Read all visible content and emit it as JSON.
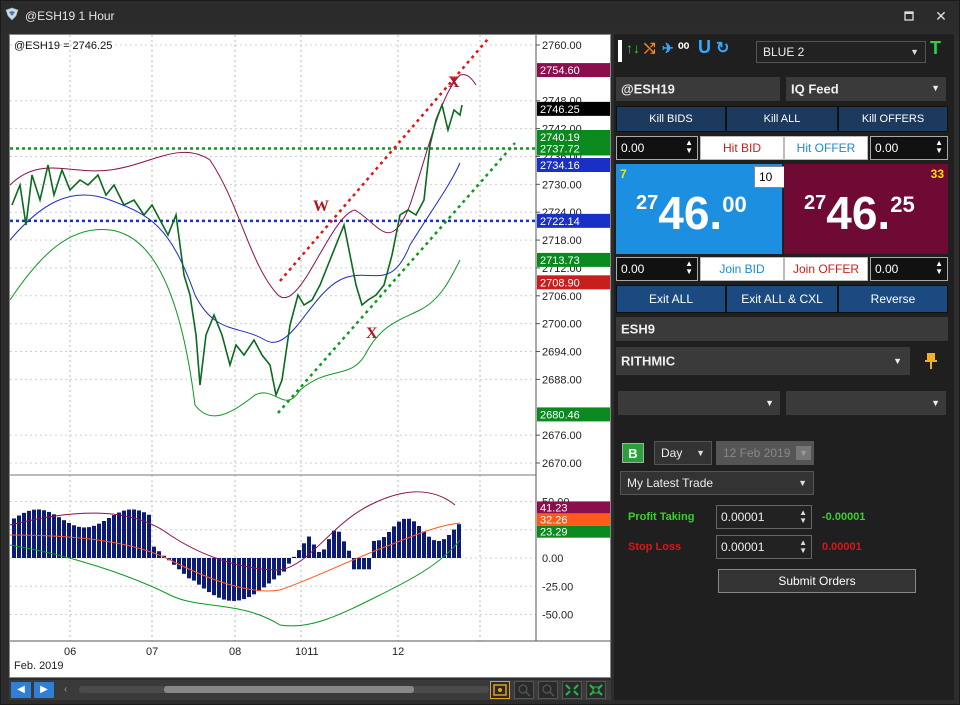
{
  "window": {
    "title": "@ESH19 1 Hour",
    "maximize_icon": "maximize-icon",
    "close_icon": "close-icon"
  },
  "chart": {
    "info": "@ESH19 = 2746.25",
    "date_label": "Feb. 2019",
    "x_labels": [
      "06",
      "07",
      "08",
      "1011",
      "12"
    ],
    "price_ticks": [
      "2760.00",
      "2748.00",
      "2742.00",
      "2736.00",
      "2730.00",
      "2724.00",
      "2718.00",
      "2712.00",
      "2706.00",
      "2700.00",
      "2694.00",
      "2688.00",
      "2676.00",
      "2670.00"
    ],
    "osc_ticks": [
      "50.00",
      "25.00",
      "0.00",
      "-25.00",
      "-50.00"
    ],
    "price_tags": [
      {
        "text": "2754.60",
        "bg": "#8b0f4e",
        "fg": "#ffffff"
      },
      {
        "text": "2746.25",
        "bg": "#000000",
        "fg": "#ffffff"
      },
      {
        "text": "2740.19",
        "bg": "#0a8a1e",
        "fg": "#ffffff"
      },
      {
        "text": "2737.72",
        "bg": "#0a8a1e",
        "fg": "#ffffff"
      },
      {
        "text": "2734.16",
        "bg": "#1a2ec8",
        "fg": "#ffffff"
      },
      {
        "text": "2722.14",
        "bg": "#1a2ec8",
        "fg": "#ffffff"
      },
      {
        "text": "2713.73",
        "bg": "#0a8a1e",
        "fg": "#ffffff"
      },
      {
        "text": "2708.90",
        "bg": "#c81e1e",
        "fg": "#ffffff"
      },
      {
        "text": "2680.46",
        "bg": "#0a8a1e",
        "fg": "#ffffff"
      }
    ],
    "osc_tags": [
      {
        "text": "41.23",
        "bg": "#8b0f4e"
      },
      {
        "text": "32.26",
        "bg": "#ff5a1a"
      },
      {
        "text": "23.29",
        "bg": "#0a8a1e"
      }
    ],
    "annotations": [
      "W",
      "X",
      "X"
    ]
  },
  "panel": {
    "toolbar_icons": [
      "arrows-icon",
      "shuffle-icon",
      "pin-icon",
      "counter-icon",
      "magnet-icon",
      "refresh-icon"
    ],
    "toolbar_glyphs": [
      "↑↓",
      "⤭",
      "✈",
      "⁰⁰",
      "U",
      "↻",
      "T"
    ],
    "account_select": "BLUE 2",
    "symbol": "@ESH19",
    "feed_select": "IQ Feed",
    "kill_bids": "Kill BIDS",
    "kill_all": "Kill ALL",
    "kill_offers": "Kill OFFERS",
    "bid_offset": "0.00",
    "hit_bid": "Hit BID",
    "hit_offer": "Hit OFFER",
    "offer_offset": "0.00",
    "bid_size": "7",
    "qty": "10",
    "offer_size": "33",
    "bid_price_prefix": "27",
    "bid_price_main": "46.",
    "bid_price_frac": "00",
    "offer_price_prefix": "27",
    "offer_price_main": "46.",
    "offer_price_frac": "25",
    "join_bid_offset": "0.00",
    "join_bid": "Join BID",
    "join_offer": "Join OFFER",
    "join_offer_offset": "0.00",
    "exit_all": "Exit ALL",
    "exit_all_cxl": "Exit ALL & CXL",
    "reverse": "Reverse",
    "contract": "ESH9",
    "broker_select": "RITHMIC",
    "sub_select_a": "",
    "sub_select_b": "",
    "b_button": "B",
    "tif_select": "Day",
    "date_select": "12 Feb 2019",
    "strategy_select": "My Latest Trade",
    "profit_label": "Profit Taking",
    "profit_value": "0.00001",
    "profit_result": "-0.00001",
    "stop_label": "Stop Loss",
    "stop_value": "0.00001",
    "stop_result": "0.00001",
    "submit": "Submit Orders"
  },
  "colors": {
    "bid_bg": "#1c8fe0",
    "offer_bg": "#6e0a33",
    "bid_size": "#ffe000",
    "offer_size": "#ffe000",
    "profit_green": "#39d12b",
    "stop_red": "#e01414"
  }
}
